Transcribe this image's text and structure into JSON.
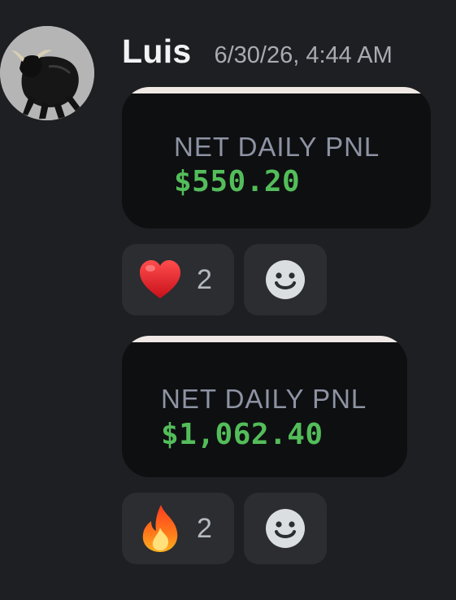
{
  "message": {
    "author": "Luis",
    "timestamp": "6/30/26, 4:44 AM",
    "avatar_icon": "bull-avatar-icon"
  },
  "attachments": [
    {
      "label": "NET DAILY PNL",
      "amount": "$550.20"
    },
    {
      "label": "NET DAILY PNL",
      "amount": "$1,062.40"
    }
  ],
  "reactions": [
    {
      "emoji": "heart-emoji-icon",
      "count": "2"
    },
    {
      "emoji": "fire-emoji-icon",
      "count": "2"
    }
  ],
  "add_reaction_icon": "smiley-face-icon",
  "colors": {
    "background": "#1e1f22",
    "card": "#0e0f11",
    "pnl_green": "#53bd5a",
    "label_gray": "#8d93a3",
    "reaction_bg": "#2b2d31"
  }
}
